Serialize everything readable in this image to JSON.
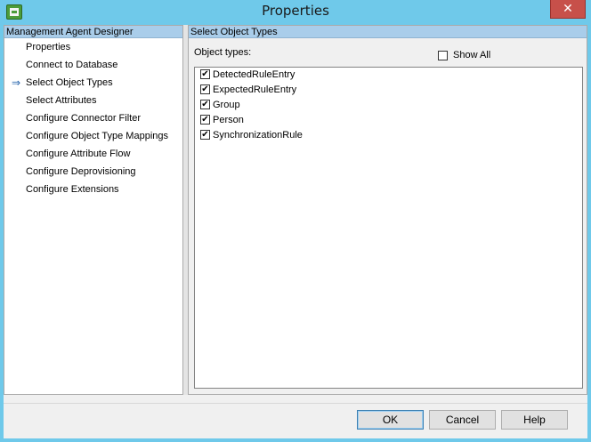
{
  "window": {
    "title": "Properties",
    "close_glyph": "✕",
    "app_icon": "ma-designer-icon"
  },
  "left_pane": {
    "header": "Management Agent Designer",
    "items": [
      {
        "label": "Properties",
        "selected": false
      },
      {
        "label": "Connect to Database",
        "selected": false
      },
      {
        "label": "Select Object Types",
        "selected": true
      },
      {
        "label": "Select Attributes",
        "selected": false
      },
      {
        "label": "Configure Connector Filter",
        "selected": false
      },
      {
        "label": "Configure Object Type Mappings",
        "selected": false
      },
      {
        "label": "Configure Attribute Flow",
        "selected": false
      },
      {
        "label": "Configure Deprovisioning",
        "selected": false
      },
      {
        "label": "Configure Extensions",
        "selected": false
      }
    ],
    "current_marker": "⇒"
  },
  "right_pane": {
    "header": "Select Object Types",
    "object_types_label": "Object types:",
    "show_all": {
      "label": "Show All",
      "checked": false
    },
    "object_types": [
      {
        "label": "DetectedRuleEntry",
        "checked": true
      },
      {
        "label": "ExpectedRuleEntry",
        "checked": true
      },
      {
        "label": "Group",
        "checked": true
      },
      {
        "label": "Person",
        "checked": true
      },
      {
        "label": "SynchronizationRule",
        "checked": true
      }
    ]
  },
  "buttons": {
    "ok": "OK",
    "cancel": "Cancel",
    "help": "Help"
  },
  "colors": {
    "title_bar": "#6fc9ea",
    "header_bar": "#a9cdea",
    "close_button": "#c7504a"
  }
}
